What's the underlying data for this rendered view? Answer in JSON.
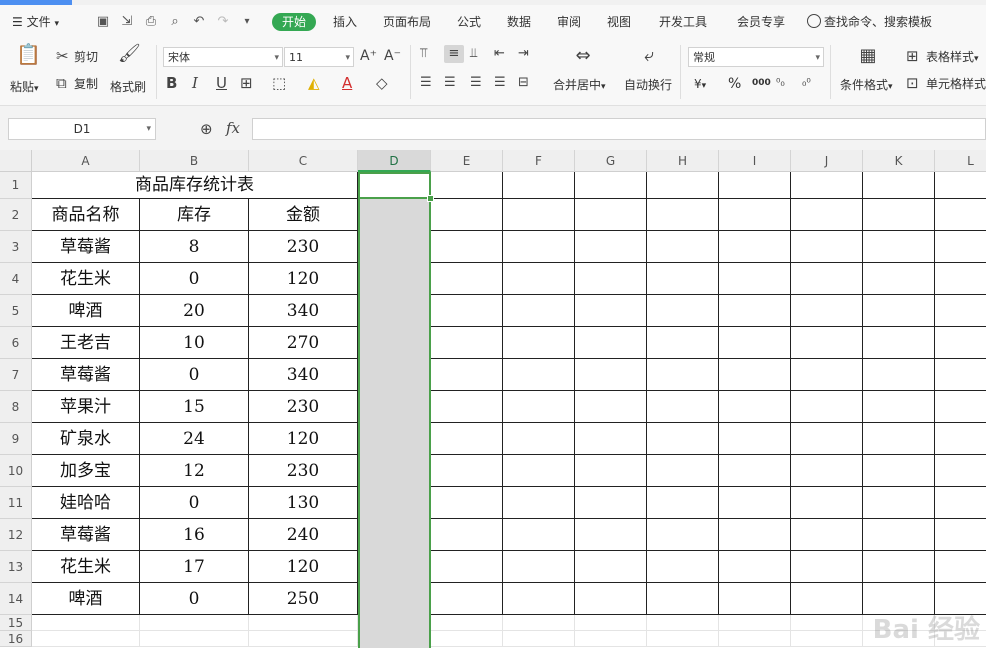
{
  "menu": {
    "file": "文件",
    "tabs": [
      "开始",
      "插入",
      "页面布局",
      "公式",
      "数据",
      "审阅",
      "视图",
      "开发工具",
      "会员专享"
    ],
    "search": "查找命令、搜索模板"
  },
  "ribbon": {
    "paste": "粘贴",
    "cut": "剪切",
    "copy": "复制",
    "format_painter": "格式刷",
    "font_name": "宋体",
    "font_size": "11",
    "merge_center": "合并居中",
    "wrap_text": "自动换行",
    "number_format": "常规",
    "currency_symbol": "¥",
    "percent_symbol": "%",
    "thousands_symbol": "000",
    "conditional_format": "条件格式",
    "table_style": "表格样式",
    "cell_style": "单元格样式"
  },
  "formula_bar": {
    "name_box": "D1",
    "fx": "fx",
    "content": ""
  },
  "sheet": {
    "columns": [
      "A",
      "B",
      "C",
      "D",
      "E",
      "F",
      "G",
      "H",
      "I",
      "J",
      "K",
      "L"
    ],
    "rows": [
      "1",
      "2",
      "3",
      "4",
      "5",
      "6",
      "7",
      "8",
      "9",
      "10",
      "11",
      "12",
      "13",
      "14",
      "15",
      "16"
    ],
    "selected_column": "D",
    "title": "商品库存统计表",
    "headers": [
      "商品名称",
      "库存",
      "金额"
    ],
    "data": [
      [
        "草莓酱",
        "8",
        "230"
      ],
      [
        "花生米",
        "0",
        "120"
      ],
      [
        "啤酒",
        "20",
        "340"
      ],
      [
        "王老吉",
        "10",
        "270"
      ],
      [
        "草莓酱",
        "0",
        "340"
      ],
      [
        "苹果汁",
        "15",
        "230"
      ],
      [
        "矿泉水",
        "24",
        "120"
      ],
      [
        "加多宝",
        "12",
        "230"
      ],
      [
        "娃哈哈",
        "0",
        "130"
      ],
      [
        "草莓酱",
        "16",
        "240"
      ],
      [
        "花生米",
        "17",
        "120"
      ],
      [
        "啤酒",
        "0",
        "250"
      ]
    ]
  },
  "watermark": "Bai 经验"
}
